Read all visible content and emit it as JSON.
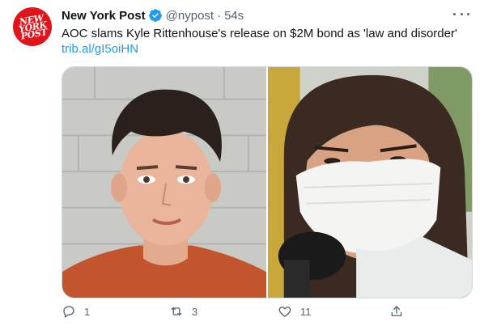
{
  "account": {
    "display_name": "New York Post",
    "handle": "@nypost",
    "separator": "·",
    "time": "54s",
    "verified": true,
    "avatar_logo_text": "NEW\nYORK\nPOST",
    "avatar_color": "#e2141b"
  },
  "tweet": {
    "text": "AOC slams Kyle Rittenhouse's release on $2M bond as 'law and disorder'",
    "link": "trib.al/gI5oiHN"
  },
  "actions": {
    "reply_count": "1",
    "retweet_count": "3",
    "like_count": "11"
  },
  "icons": {
    "verified": "verified-badge-icon",
    "more": "more-icon",
    "reply": "reply-icon",
    "retweet": "retweet-icon",
    "like": "like-icon",
    "share": "share-icon"
  },
  "colors": {
    "link": "#1d9bf0",
    "muted": "#536471",
    "verified": "#1d9bf0"
  }
}
